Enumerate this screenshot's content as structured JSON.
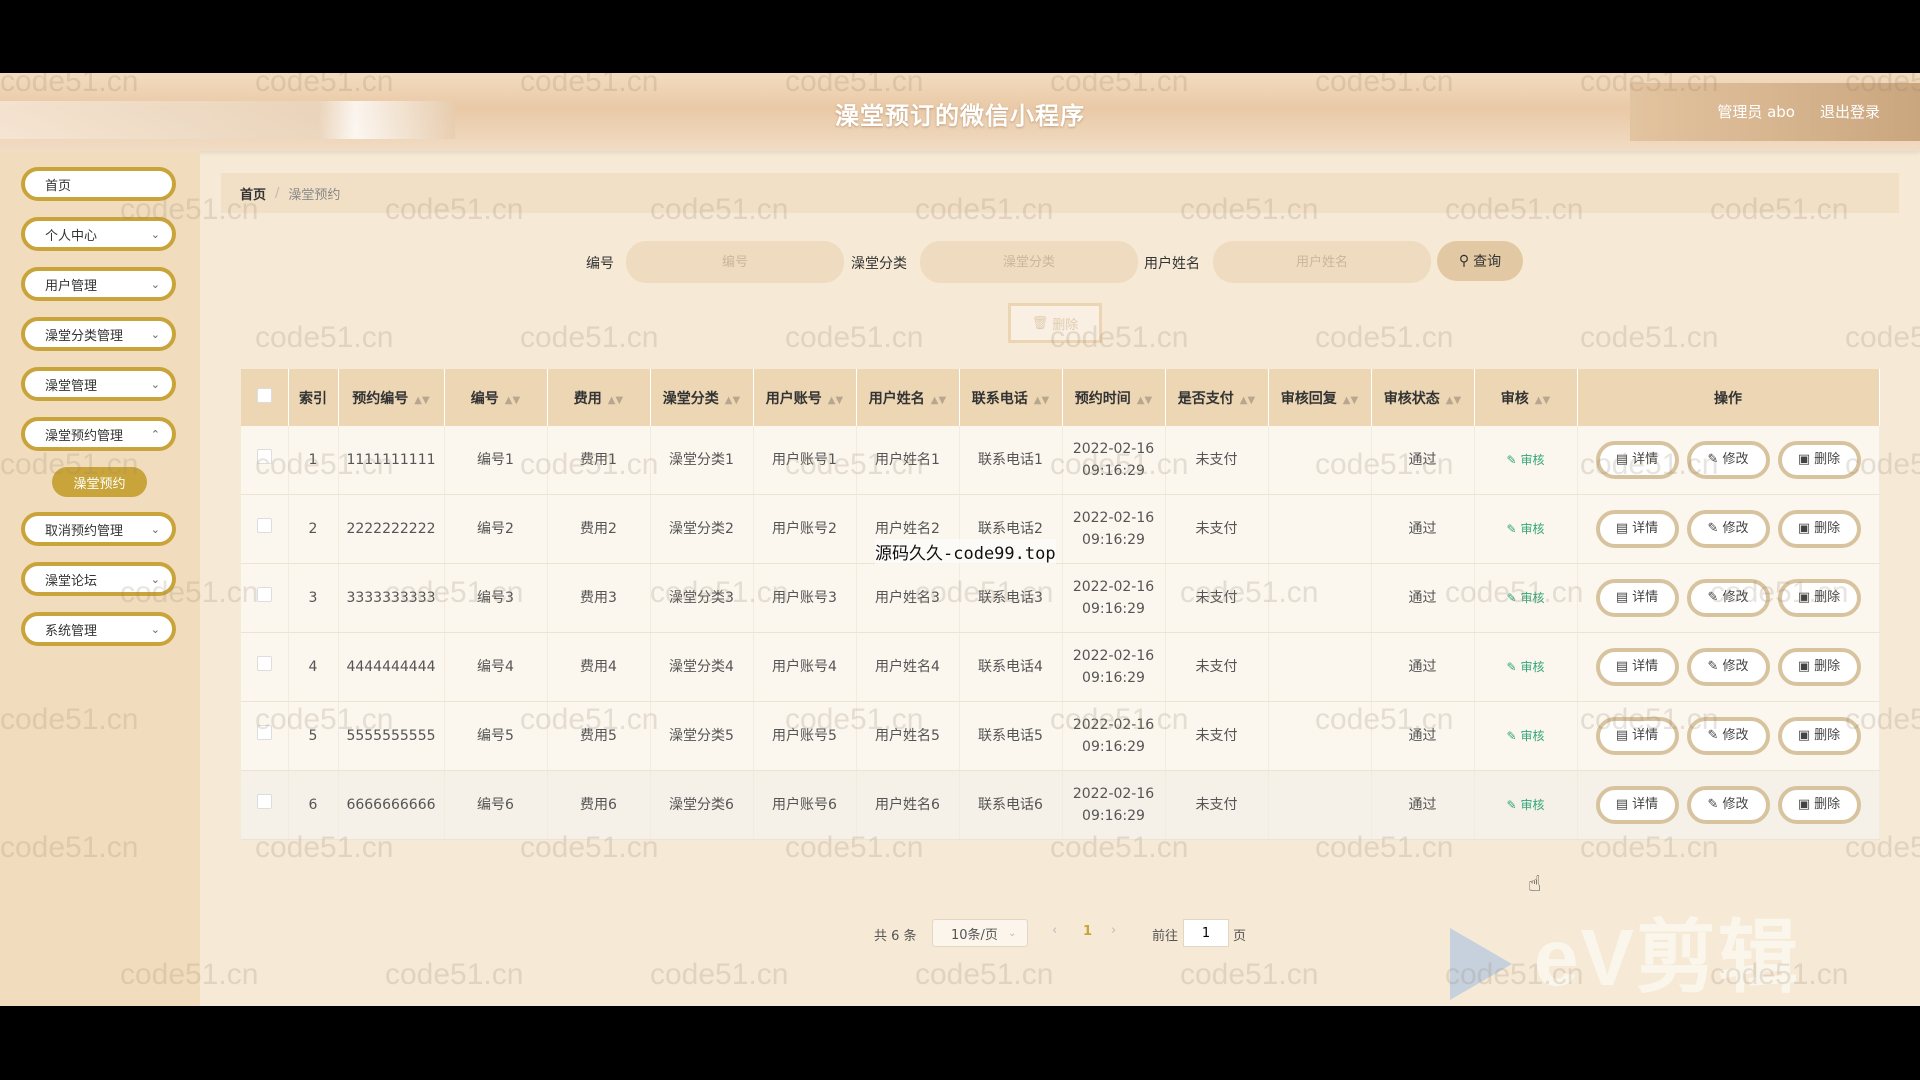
{
  "header": {
    "title": "澡堂预订的微信小程序",
    "user": "管理员 abo",
    "logout": "退出登录"
  },
  "sidebar": {
    "items": [
      {
        "label": "首页"
      },
      {
        "label": "个人中心"
      },
      {
        "label": "用户管理"
      },
      {
        "label": "澡堂分类管理"
      },
      {
        "label": "澡堂管理"
      },
      {
        "label": "澡堂预约管理"
      },
      {
        "label": "取消预约管理"
      },
      {
        "label": "澡堂论坛"
      },
      {
        "label": "系统管理"
      }
    ],
    "active_sub": "澡堂预约"
  },
  "breadcrumb": {
    "home": "首页",
    "separator": "/",
    "current": "澡堂预约"
  },
  "search": {
    "fields": [
      {
        "label": "编号",
        "placeholder": "编号"
      },
      {
        "label": "澡堂分类",
        "placeholder": "澡堂分类"
      },
      {
        "label": "用户姓名",
        "placeholder": "用户姓名"
      }
    ],
    "button": "查询"
  },
  "bulk_delete": "删除",
  "table": {
    "columns": [
      "索引",
      "预约编号",
      "编号",
      "费用",
      "澡堂分类",
      "用户账号",
      "用户姓名",
      "联系电话",
      "预约时间",
      "是否支付",
      "审核回复",
      "审核状态",
      "审核",
      "操作"
    ],
    "audit_label": "审核",
    "actions": [
      "详情",
      "修改",
      "删除"
    ],
    "rows": [
      {
        "index": "1",
        "booking_no": "1111111111",
        "no": "编号1",
        "fee": "费用1",
        "category": "澡堂分类1",
        "account": "用户账号1",
        "name": "用户姓名1",
        "phone": "联系电话1",
        "date": "2022-02-16",
        "time": "09:16:29",
        "paid": "未支付",
        "reply": "",
        "status": "通过"
      },
      {
        "index": "2",
        "booking_no": "2222222222",
        "no": "编号2",
        "fee": "费用2",
        "category": "澡堂分类2",
        "account": "用户账号2",
        "name": "用户姓名2",
        "phone": "联系电话2",
        "date": "2022-02-16",
        "time": "09:16:29",
        "paid": "未支付",
        "reply": "",
        "status": "通过"
      },
      {
        "index": "3",
        "booking_no": "3333333333",
        "no": "编号3",
        "fee": "费用3",
        "category": "澡堂分类3",
        "account": "用户账号3",
        "name": "用户姓名3",
        "phone": "联系电话3",
        "date": "2022-02-16",
        "time": "09:16:29",
        "paid": "未支付",
        "reply": "",
        "status": "通过"
      },
      {
        "index": "4",
        "booking_no": "4444444444",
        "no": "编号4",
        "fee": "费用4",
        "category": "澡堂分类4",
        "account": "用户账号4",
        "name": "用户姓名4",
        "phone": "联系电话4",
        "date": "2022-02-16",
        "time": "09:16:29",
        "paid": "未支付",
        "reply": "",
        "status": "通过"
      },
      {
        "index": "5",
        "booking_no": "5555555555",
        "no": "编号5",
        "fee": "费用5",
        "category": "澡堂分类5",
        "account": "用户账号5",
        "name": "用户姓名5",
        "phone": "联系电话5",
        "date": "2022-02-16",
        "time": "09:16:29",
        "paid": "未支付",
        "reply": "",
        "status": "通过"
      },
      {
        "index": "6",
        "booking_no": "6666666666",
        "no": "编号6",
        "fee": "费用6",
        "category": "澡堂分类6",
        "account": "用户账号6",
        "name": "用户姓名6",
        "phone": "联系电话6",
        "date": "2022-02-16",
        "time": "09:16:29",
        "paid": "未支付",
        "reply": "",
        "status": "通过"
      }
    ]
  },
  "pagination": {
    "total": "共 6 条",
    "page_size": "10条/页",
    "current_page": "1",
    "goto_label": "前往",
    "goto_value": "1",
    "page_suffix": "页"
  },
  "overlay": {
    "caption": "源码久久-code99.top",
    "watermark": "code51.cn",
    "logo": "eV剪辑"
  },
  "colors": {
    "accent": "#c9a43a",
    "header_bg": "#e9c9a6",
    "table_header": "#ecd6b4",
    "audit_link": "#33a67a"
  }
}
